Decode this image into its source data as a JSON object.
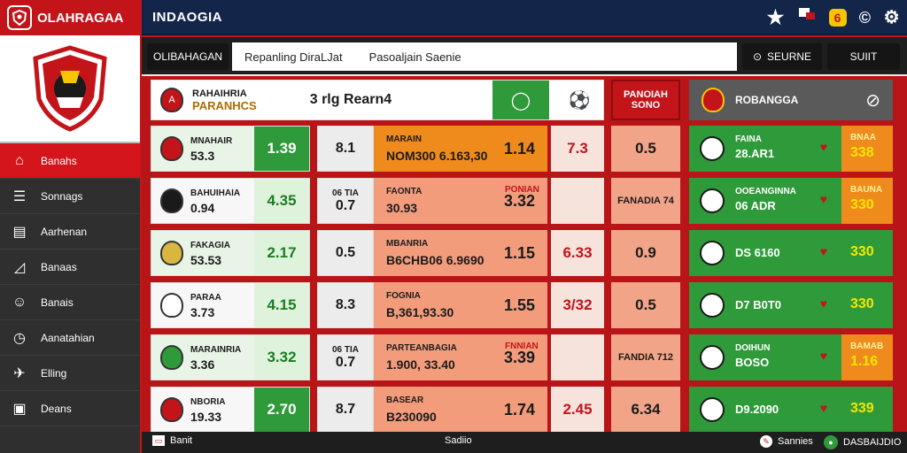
{
  "app": {
    "brand": "OLAHRAGAA",
    "title": "INDAOGIA"
  },
  "top_icons": [
    "star-icon",
    "flag-icon",
    "badge-6",
    "copyright-icon",
    "settings-icon"
  ],
  "top_badge": "6",
  "sidebar": {
    "items": [
      {
        "label": "Banahs",
        "icon": "home-icon"
      },
      {
        "label": "Sonnags",
        "icon": "sliders-icon"
      },
      {
        "label": "Aarhenan",
        "icon": "window-icon"
      },
      {
        "label": "Banaas",
        "icon": "chart-icon"
      },
      {
        "label": "Banais",
        "icon": "user-icon"
      },
      {
        "label": "Aanatahian",
        "icon": "clock-icon"
      },
      {
        "label": "Elling",
        "icon": "bird-icon"
      },
      {
        "label": "Deans",
        "icon": "document-icon"
      }
    ]
  },
  "toolbar": {
    "left_button": "OLIBAHAGAN",
    "search_text_1": "Repanling DiraLJat",
    "search_text_2": "Pasoaljain Saenie",
    "search_button": "SEURNE",
    "right_button": "SUIIT"
  },
  "header_row": {
    "team_title_1": "RAHAIHRIA",
    "team_title_2": "PARANHCS",
    "mid_text": "3  rlg  Rearn4",
    "red_box": "PANOIAH SONO",
    "right_title": "ROBANGGA"
  },
  "rows": [
    {
      "name": "MNAHAIR",
      "val": "53.3",
      "g": "1.39",
      "mid1": "8.1",
      "mid2": "",
      "mname": "MARAIN",
      "mval": "NOM300 6.163,30",
      "odd": "1.14",
      "o2": "7.3",
      "o3": "0.5",
      "rname": "FAINA",
      "rval": "28.AR1",
      "rtag": "BNAA",
      "rnum": "338"
    },
    {
      "name": "BAHUIHAIA",
      "val": "0.94",
      "g": "4.35",
      "mid1": "06 TIA",
      "mid2": "0.7",
      "mname": "FAONTA",
      "mval": "30.93",
      "odd": "3.32",
      "o2": "",
      "o3": "FANADIA 74",
      "rname": "OOEANGINNA",
      "rval": "06 ADR",
      "rtag": "BAUNA",
      "rnum": "330",
      "msub": "PONIAN"
    },
    {
      "name": "FAKAGIA",
      "val": "53.53",
      "g": "2.17",
      "mid1": "0.5",
      "mid2": "",
      "mname": "MBANRIA",
      "mval": "B6CHB06 6.9690",
      "odd": "1.15",
      "o2": "6.33",
      "o3": "0.9",
      "rname": "",
      "rval": "DS 6160",
      "rtag": "",
      "rnum": "330"
    },
    {
      "name": "PARAA",
      "val": "3.73",
      "g": "4.15",
      "mid1": "8.3",
      "mid2": "",
      "mname": "FOGNIA",
      "mval": "B,361,93.30",
      "odd": "1.55",
      "o2": "3/32",
      "o3": "0.5",
      "rname": "",
      "rval": "D7 B0T0",
      "rtag": "",
      "rnum": "330"
    },
    {
      "name": "MARAINRIA",
      "val": "3.36",
      "g": "3.32",
      "mid1": "06 TIA",
      "mid2": "0.7",
      "mname": "PARTEANBAGIA",
      "mval": "1.900, 33.40",
      "odd": "3.39",
      "o2": "",
      "o3": "FANDIA 712",
      "rname": "DOIHUN",
      "rval": "BOSO",
      "rtag": "BAMAB",
      "rnum": "1.16",
      "msub": "FNNIAN"
    },
    {
      "name": "NBORIA",
      "val": "19.33",
      "g": "2.70",
      "mid1": "8.7",
      "mid2": "",
      "mname": "BASEAR",
      "mval": "B230090",
      "odd": "1.74",
      "o2": "2.45",
      "o3": "6.34",
      "rname": "",
      "rval": "D9.2090",
      "rtag": "",
      "rnum": "339"
    }
  ],
  "footer": {
    "left": "Banit",
    "center": "Sadiio",
    "right1": "Sannies",
    "right2": "DASBAIJDIO"
  },
  "colors": {
    "primary_red": "#c3141a",
    "navy": "#13264a",
    "green": "#2f9a3a",
    "orange": "#ef8a1c",
    "salmon": "#f39c7c"
  }
}
